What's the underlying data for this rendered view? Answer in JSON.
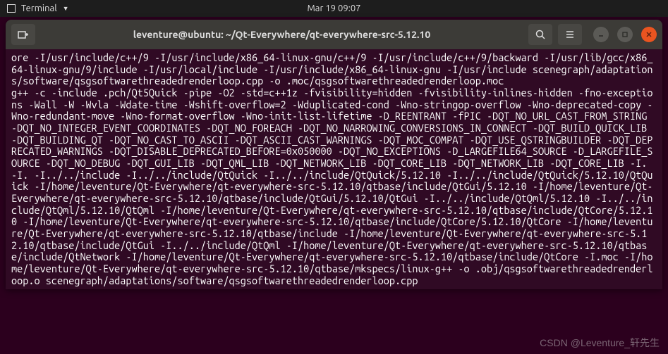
{
  "top_bar": {
    "app_label": "Terminal",
    "datetime": "Mar 19  09:07"
  },
  "titlebar": {
    "title": "leventure@ubuntu: ~/Qt-Everywhere/qt-everywhere-src-5.12.10"
  },
  "terminal": {
    "output": "ore -I/usr/include/c++/9 -I/usr/include/x86_64-linux-gnu/c++/9 -I/usr/include/c++/9/backward -I/usr/lib/gcc/x86_64-linux-gnu/9/include -I/usr/local/include -I/usr/include/x86_64-linux-gnu -I/usr/include scenegraph/adaptations/software/qsgsoftwarethreadedrenderloop.cpp -o .moc/qsgsoftwarethreadedrenderloop.moc\ng++ -c -include .pch/Qt5Quick -pipe -O2 -std=c++1z -fvisibility=hidden -fvisibility-inlines-hidden -fno-exceptions -Wall -W -Wvla -Wdate-time -Wshift-overflow=2 -Wduplicated-cond -Wno-stringop-overflow -Wno-deprecated-copy -Wno-redundant-move -Wno-format-overflow -Wno-init-list-lifetime -D_REENTRANT -fPIC -DQT_NO_URL_CAST_FROM_STRING -DQT_NO_INTEGER_EVENT_COORDINATES -DQT_NO_FOREACH -DQT_NO_NARROWING_CONVERSIONS_IN_CONNECT -DQT_BUILD_QUICK_LIB -DQT_BUILDING_QT -DQT_NO_CAST_TO_ASCII -DQT_ASCII_CAST_WARNINGS -DQT_MOC_COMPAT -DQT_USE_QSTRINGBUILDER -DQT_DEPRECATED_WARNINGS -DQT_DISABLE_DEPRECATED_BEFORE=0x050000 -DQT_NO_EXCEPTIONS -D_LARGEFILE64_SOURCE -D_LARGEFILE_SOURCE -DQT_NO_DEBUG -DQT_GUI_LIB -DQT_QML_LIB -DQT_NETWORK_LIB -DQT_CORE_LIB -DQT_NETWORK_LIB -DQT_CORE_LIB -I. -I. -I../../include -I../../include/QtQuick -I../../include/QtQuick/5.12.10 -I../../include/QtQuick/5.12.10/QtQuick -I/home/leventure/Qt-Everywhere/qt-everywhere-src-5.12.10/qtbase/include/QtGui/5.12.10 -I/home/leventure/Qt-Everywhere/qt-everywhere-src-5.12.10/qtbase/include/QtGui/5.12.10/QtGui -I../../include/QtQml/5.12.10 -I../../include/QtQml/5.12.10/QtQml -I/home/leventure/Qt-Everywhere/qt-everywhere-src-5.12.10/qtbase/include/QtCore/5.12.10 -I/home/leventure/Qt-Everywhere/qt-everywhere-src-5.12.10/qtbase/include/QtCore/5.12.10/QtCore -I/home/leventure/Qt-Everywhere/qt-everywhere-src-5.12.10/qtbase/include -I/home/leventure/Qt-Everywhere/qt-everywhere-src-5.12.10/qtbase/include/QtGui -I../../include/QtQml -I/home/leventure/Qt-Everywhere/qt-everywhere-src-5.12.10/qtbase/include/QtNetwork -I/home/leventure/Qt-Everywhere/qt-everywhere-src-5.12.10/qtbase/include/QtCore -I.moc -I/home/leventure/Qt-Everywhere/qt-everywhere-src-5.12.10/qtbase/mkspecs/linux-g++ -o .obj/qsgsoftwarethreadedrenderloop.o scenegraph/adaptations/software/qsgsoftwarethreadedrenderloop.cpp"
  },
  "watermark": "CSDN @Leventure_轩先生"
}
